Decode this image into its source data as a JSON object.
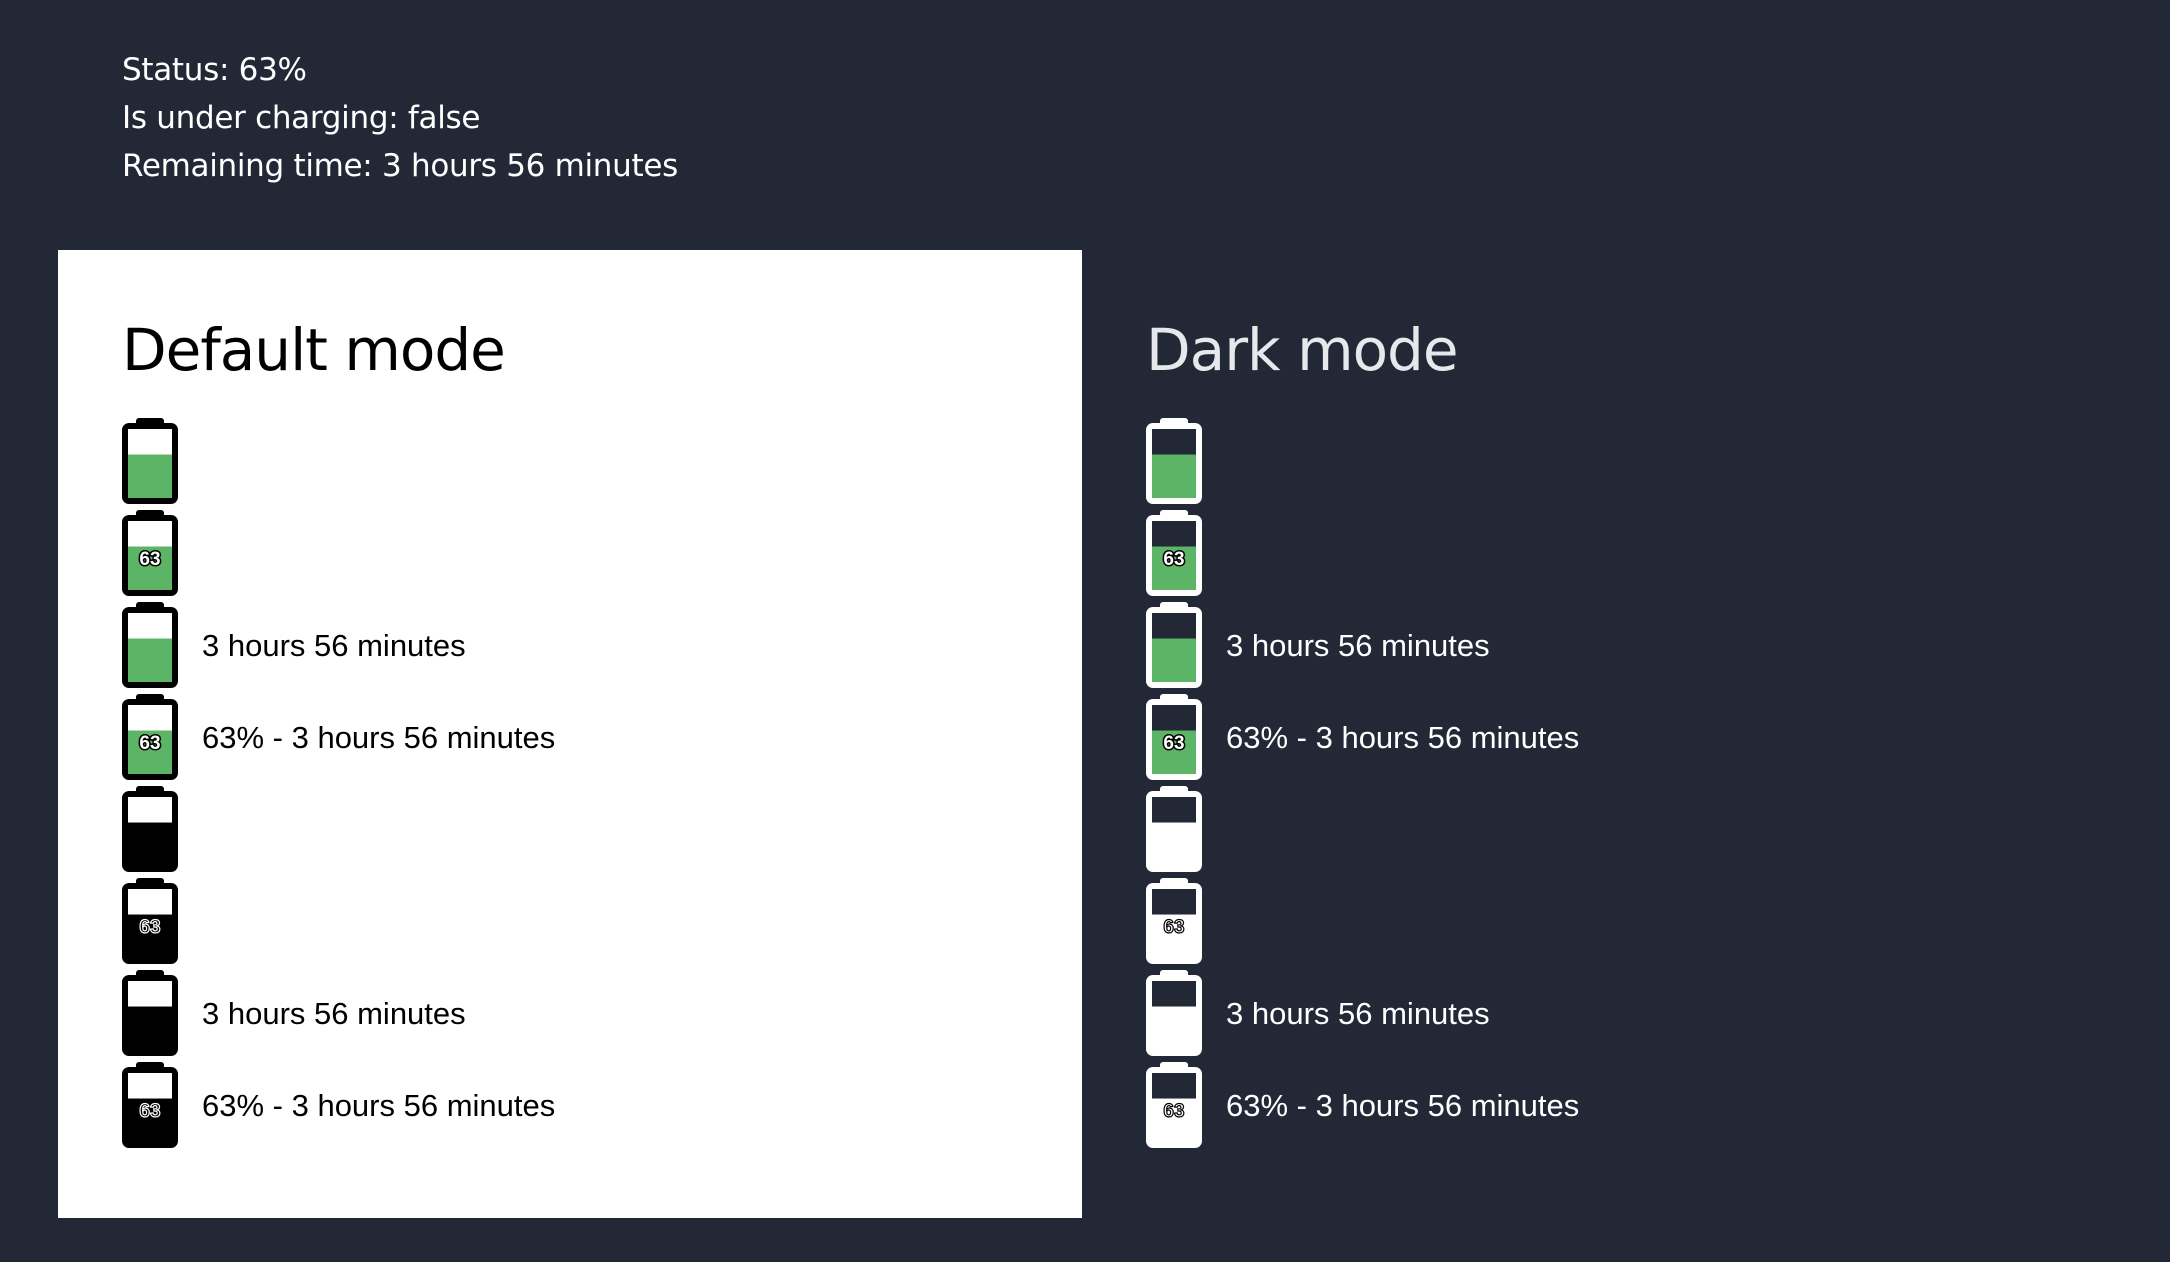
{
  "status": {
    "status_line": "Status: 63%",
    "charging_line": "Is under charging: false",
    "remaining_line": "Remaining time: 3 hours 56 minutes"
  },
  "battery": {
    "level_percent": 63,
    "level_label": "63",
    "time_text": "3 hours 56 minutes",
    "combined_text": "63% - 3 hours 56 minutes"
  },
  "panels": [
    {
      "title": "Default mode",
      "theme": "light",
      "colors": {
        "outline": "#000000",
        "empty": "#ffffff",
        "fill_color": "#5cb466",
        "fill_mono": "#000000",
        "page": "#ffffff"
      },
      "rows": [
        {
          "style": "color",
          "show_percent": false,
          "label": ""
        },
        {
          "style": "color",
          "show_percent": true,
          "label": ""
        },
        {
          "style": "color",
          "show_percent": false,
          "label": "3 hours 56 minutes"
        },
        {
          "style": "color",
          "show_percent": true,
          "label": "63% - 3 hours 56 minutes"
        },
        {
          "style": "mono",
          "show_percent": false,
          "label": ""
        },
        {
          "style": "mono",
          "show_percent": true,
          "label": ""
        },
        {
          "style": "mono",
          "show_percent": false,
          "label": "3 hours 56 minutes"
        },
        {
          "style": "mono",
          "show_percent": true,
          "label": "63% - 3 hours 56 minutes"
        }
      ]
    },
    {
      "title": "Dark mode",
      "theme": "dark",
      "colors": {
        "outline": "#ffffff",
        "empty": "#222836",
        "fill_color": "#5cb466",
        "fill_mono": "#ffffff",
        "page": "#222836"
      },
      "rows": [
        {
          "style": "color",
          "show_percent": false,
          "label": ""
        },
        {
          "style": "color",
          "show_percent": true,
          "label": ""
        },
        {
          "style": "color",
          "show_percent": false,
          "label": "3 hours 56 minutes"
        },
        {
          "style": "color",
          "show_percent": true,
          "label": "63% - 3 hours 56 minutes"
        },
        {
          "style": "mono",
          "show_percent": false,
          "label": ""
        },
        {
          "style": "mono",
          "show_percent": true,
          "label": ""
        },
        {
          "style": "mono",
          "show_percent": false,
          "label": "3 hours 56 minutes"
        },
        {
          "style": "mono",
          "show_percent": true,
          "label": "63% - 3 hours 56 minutes"
        }
      ]
    }
  ]
}
